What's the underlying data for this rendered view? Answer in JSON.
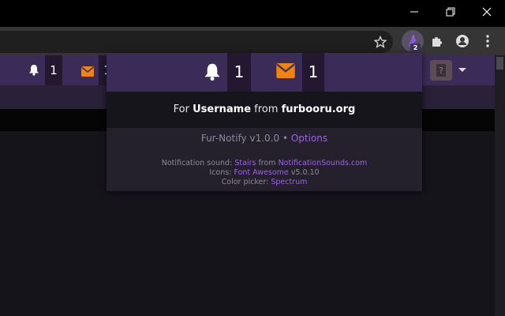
{
  "site_header": {
    "notification_count": "1",
    "message_count": "1"
  },
  "extension": {
    "badge": "2"
  },
  "popup": {
    "notification_count": "1",
    "message_count": "1",
    "user_line": {
      "prefix": "For",
      "username": "Username",
      "middle": "from",
      "site": "furbooru.org"
    },
    "version": {
      "text": "Fur-Notify v1.0.0",
      "separator": "•",
      "options_link": "Options"
    },
    "credits": {
      "sound_label": "Notification sound:",
      "sound_name": "Stairs",
      "sound_from": "from",
      "sound_source": "NotificationSounds.com",
      "icons_label": "Icons:",
      "icons_name": "Font Awesome",
      "icons_version": "v5.0.10",
      "picker_label": "Color picker:",
      "picker_name": "Spectrum"
    }
  },
  "colors": {
    "header_purple": "#3a2b58",
    "counter_bg": "#23182f",
    "mail_orange": "#f0840c",
    "link_purple": "#9d62e0"
  },
  "icons": [
    "minimize-icon",
    "restore-icon",
    "close-icon",
    "star-icon",
    "extension-icon",
    "puzzle-icon",
    "profile-icon",
    "menu-icon",
    "bell-icon",
    "envelope-icon"
  ]
}
